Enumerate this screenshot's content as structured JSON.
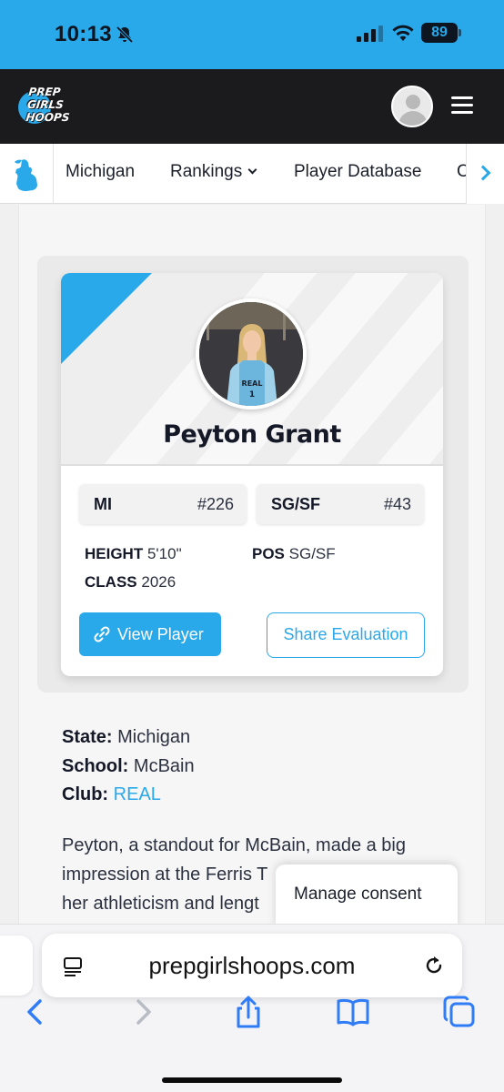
{
  "status_bar": {
    "time": "10:13",
    "battery": "89",
    "colors": {
      "background": "#29a8ea"
    }
  },
  "header": {
    "logo_text": "PREP GIRLS HOOPS",
    "icons": [
      "avatar-icon",
      "hamburger-menu-icon"
    ]
  },
  "nav": {
    "items": [
      {
        "label": "Michigan"
      },
      {
        "label": "Rankings"
      },
      {
        "label": "Player Database"
      },
      {
        "label": "C"
      }
    ],
    "icons": [
      "michigan-map-icon",
      "chevron-down-icon",
      "chevron-right-icon"
    ]
  },
  "player": {
    "name": "Peyton Grant",
    "state_rank": {
      "label": "MI",
      "value": "#226"
    },
    "position_rank": {
      "label": "SG/SF",
      "value": "#43"
    },
    "height": {
      "label": "HEIGHT",
      "value": "5'10\""
    },
    "pos": {
      "label": "POS",
      "value": "SG/SF"
    },
    "class": {
      "label": "CLASS",
      "value": "2026"
    },
    "view_button": "View Player",
    "share_button": "Share Evaluation"
  },
  "details": {
    "state": {
      "label": "State:",
      "value": "Michigan"
    },
    "school": {
      "label": "School:",
      "value": "McBain"
    },
    "club": {
      "label": "Club:",
      "value": "REAL"
    }
  },
  "article": {
    "line1": "Peyton, a standout for McBain, made a big",
    "line2": "impression at the Ferris T",
    "line3": "her athleticism and lengt"
  },
  "consent": {
    "label": "Manage consent"
  },
  "browser": {
    "url": "prepgirlshoops.com",
    "icons": [
      "reader-icon",
      "reload-icon",
      "back-icon",
      "forward-icon",
      "share-icon",
      "bookmarks-icon",
      "tabs-icon"
    ]
  },
  "colors": {
    "accent": "#29a8ea",
    "header": "#1b1b1d",
    "text": "#141827"
  }
}
